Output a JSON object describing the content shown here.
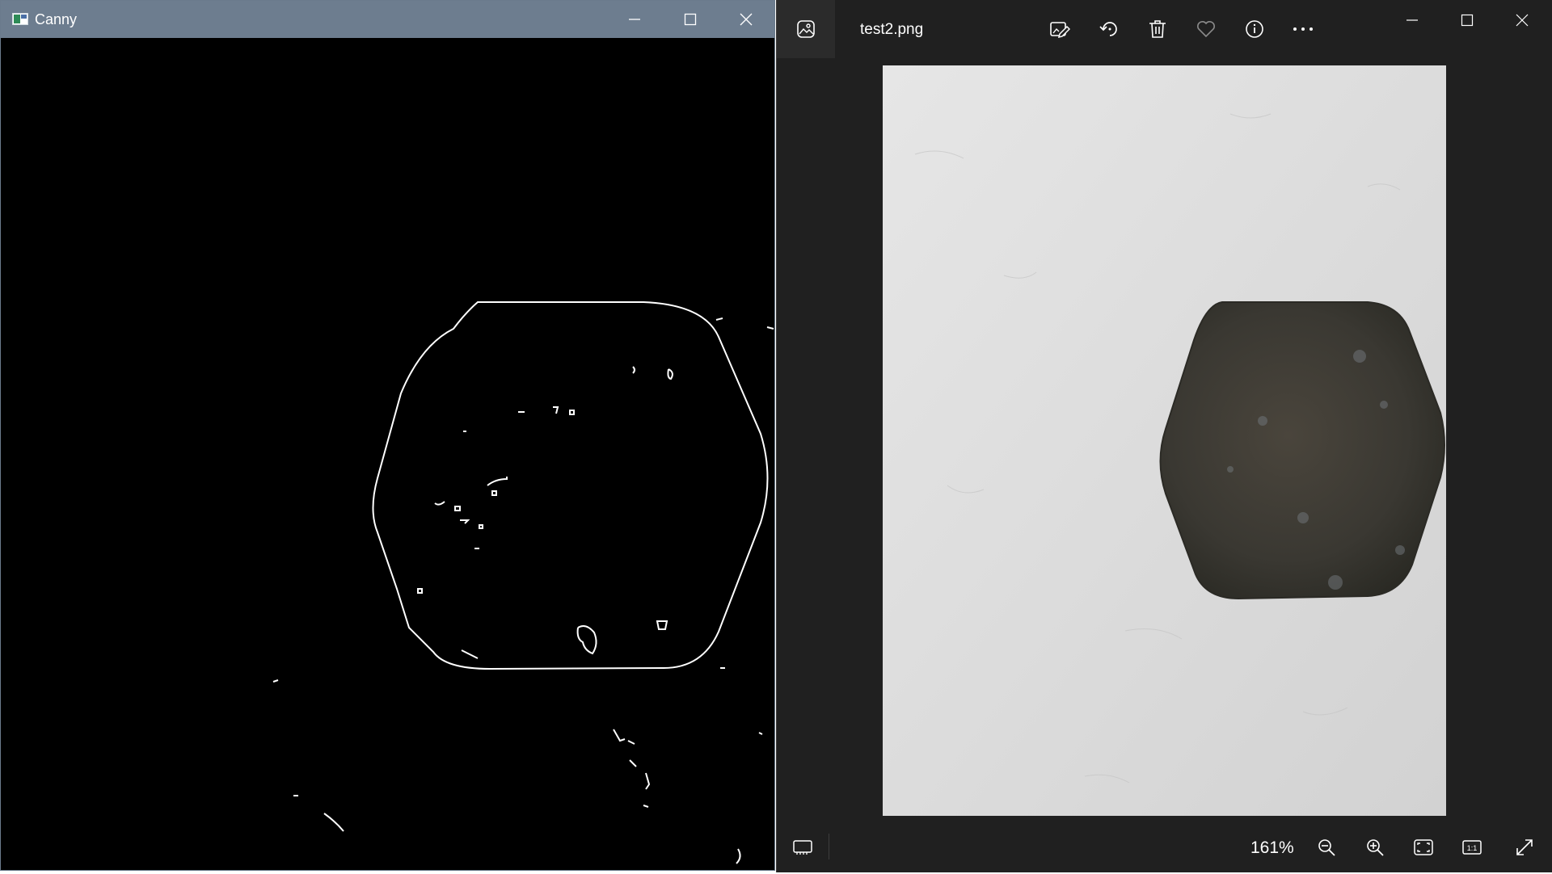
{
  "canny_window": {
    "title": "Canny",
    "controls": [
      "minimize",
      "maximize",
      "close"
    ]
  },
  "photos_window": {
    "filename": "test2.png",
    "toolbar_icons": [
      "edit-image-icon",
      "rotate-icon",
      "delete-icon",
      "favorite-icon",
      "info-icon",
      "more-icon"
    ],
    "zoom_level": "161%",
    "bottom_icons": [
      "filmstrip-icon",
      "zoom-out-icon",
      "zoom-in-icon",
      "fit-to-window-icon",
      "actual-size-icon",
      "fullscreen-icon"
    ]
  },
  "colors": {
    "canny_titlebar": "#6d7d8f",
    "canny_canvas": "#000000",
    "photos_bg": "#202020",
    "photo_wall": "#dcdcdc",
    "stone": "#3b3a35"
  }
}
